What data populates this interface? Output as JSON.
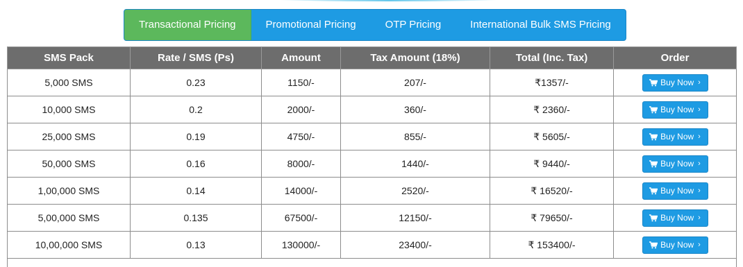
{
  "tabs": [
    {
      "label": "Transactional Pricing",
      "active": true
    },
    {
      "label": "Promotional Pricing",
      "active": false
    },
    {
      "label": "OTP Pricing",
      "active": false
    },
    {
      "label": "International Bulk SMS Pricing",
      "active": false
    }
  ],
  "table": {
    "headers": [
      "SMS Pack",
      "Rate / SMS (Ps)",
      "Amount",
      "Tax Amount (18%)",
      "Total (Inc. Tax)",
      "Order"
    ],
    "button_label": "Buy Now",
    "button_chevron": "›",
    "rows": [
      {
        "pack": "5,000 SMS",
        "rate": "0.23",
        "amount": "1150/-",
        "tax": "207/-",
        "total": "₹1357/-"
      },
      {
        "pack": "10,000 SMS",
        "rate": "0.2",
        "amount": "2000/-",
        "tax": "360/-",
        "total": "₹ 2360/-"
      },
      {
        "pack": "25,000 SMS",
        "rate": "0.19",
        "amount": "4750/-",
        "tax": "855/-",
        "total": "₹ 5605/-"
      },
      {
        "pack": "50,000 SMS",
        "rate": "0.16",
        "amount": "8000/-",
        "tax": "1440/-",
        "total": "₹ 9440/-"
      },
      {
        "pack": "1,00,000 SMS",
        "rate": "0.14",
        "amount": "14000/-",
        "tax": "2520/-",
        "total": "₹ 16520/-"
      },
      {
        "pack": "5,00,000 SMS",
        "rate": "0.135",
        "amount": "67500/-",
        "tax": "12150/-",
        "total": "₹ 79650/-"
      },
      {
        "pack": "10,00,000 SMS",
        "rate": "0.13",
        "amount": "130000/-",
        "tax": "23400/-",
        "total": "₹ 153400/-"
      }
    ]
  },
  "colors": {
    "tab_blue": "#1e9be3",
    "tab_active_green": "#5cb85c",
    "header_gray": "#6d6d6d"
  },
  "icons": {
    "buy_button": "shopping-cart-icon"
  }
}
